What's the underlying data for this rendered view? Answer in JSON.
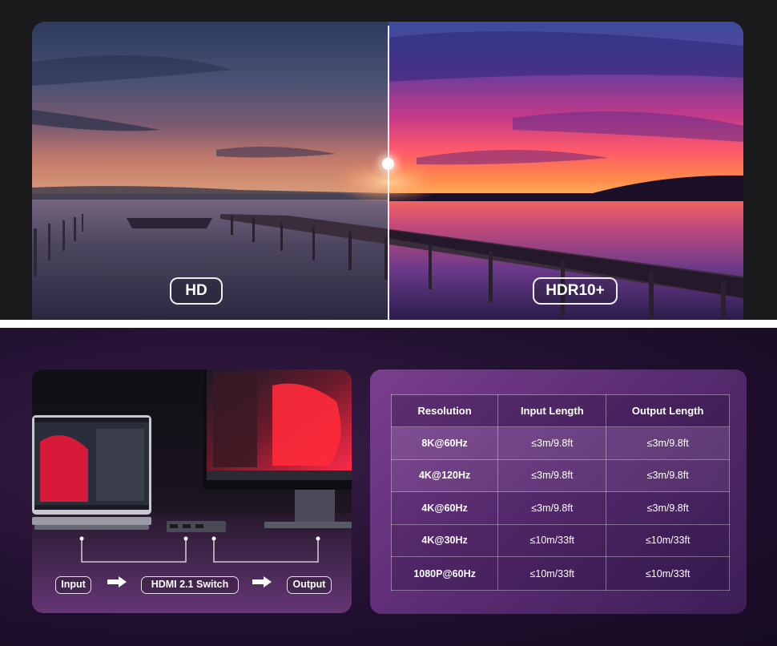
{
  "comparison": {
    "left_label": "HD",
    "right_label": "HDR10+"
  },
  "setup": {
    "flow": {
      "input_label": "Input",
      "switch_label": "HDMI 2.1 Switch",
      "output_label": "Output"
    },
    "icons": [
      "laptop-icon",
      "monitor-icon",
      "switch-device-icon",
      "arrow-right-icon"
    ]
  },
  "spec_table": {
    "headers": [
      "Resolution",
      "Input Length",
      "Output Length"
    ],
    "rows": [
      {
        "resolution": "8K@60Hz",
        "input": "≤3m/9.8ft",
        "output": "≤3m/9.8ft"
      },
      {
        "resolution": "4K@120Hz",
        "input": "≤3m/9.8ft",
        "output": "≤3m/9.8ft"
      },
      {
        "resolution": "4K@60Hz",
        "input": "≤3m/9.8ft",
        "output": "≤3m/9.8ft"
      },
      {
        "resolution": "4K@30Hz",
        "input": "≤10m/33ft",
        "output": "≤10m/33ft"
      },
      {
        "resolution": "1080P@60Hz",
        "input": "≤10m/33ft",
        "output": "≤10m/33ft"
      }
    ]
  },
  "colors": {
    "page_dark": "#1a1a1c",
    "section_purple": "#211030",
    "card_purple": "#6a3580",
    "accent_white": "#ffffff"
  }
}
